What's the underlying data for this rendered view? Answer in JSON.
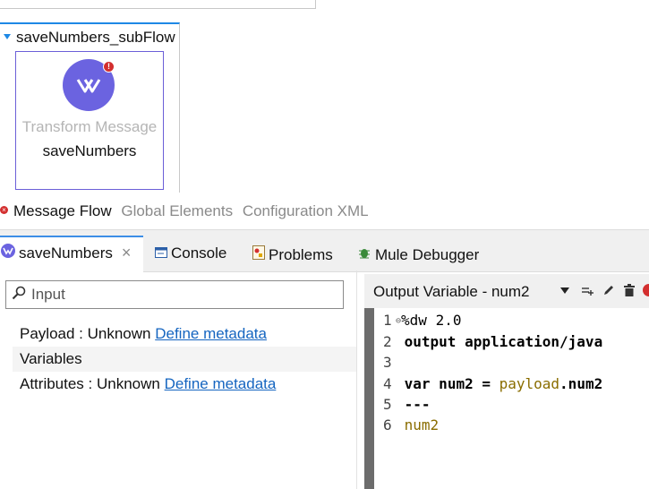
{
  "canvas": {
    "subflow_title": "saveNumbers_subFlow",
    "component_type": "Transform Message",
    "component_name": "saveNumbers",
    "component_error_badge": "!"
  },
  "editor_tabs": [
    {
      "label": "Message Flow",
      "active": true,
      "has_error": true
    },
    {
      "label": "Global Elements",
      "active": false
    },
    {
      "label": "Configuration XML",
      "active": false
    }
  ],
  "view_tabs": {
    "savenumbers": "saveNumbers",
    "close_glyph": "×",
    "console": "Console",
    "problems": "Problems",
    "debugger": "Mule Debugger"
  },
  "input_panel": {
    "search_placeholder": "Input",
    "payload_label": "Payload : Unknown",
    "payload_link": "Define metadata",
    "variables_label": "Variables",
    "attributes_label": "Attributes : Unknown",
    "attributes_link": "Define metadata"
  },
  "output_panel": {
    "title": "Output  Variable - num2"
  },
  "code": {
    "line_numbers": [
      "1",
      "2",
      "3",
      "4",
      "5",
      "6"
    ],
    "l1": "%dw 2.0",
    "l2": "output application/java",
    "l4_kw": "var",
    "l4_name": " num2 = ",
    "l4_payload": "payload",
    "l4_rest": ".num2",
    "l5": "---",
    "l6": "num2"
  },
  "colors": {
    "accent_blue": "#1e88e5",
    "component_purple": "#6b63e0",
    "error_red": "#d32f2f",
    "link_blue": "#1565c0",
    "dw_variable": "#8a6d00"
  }
}
